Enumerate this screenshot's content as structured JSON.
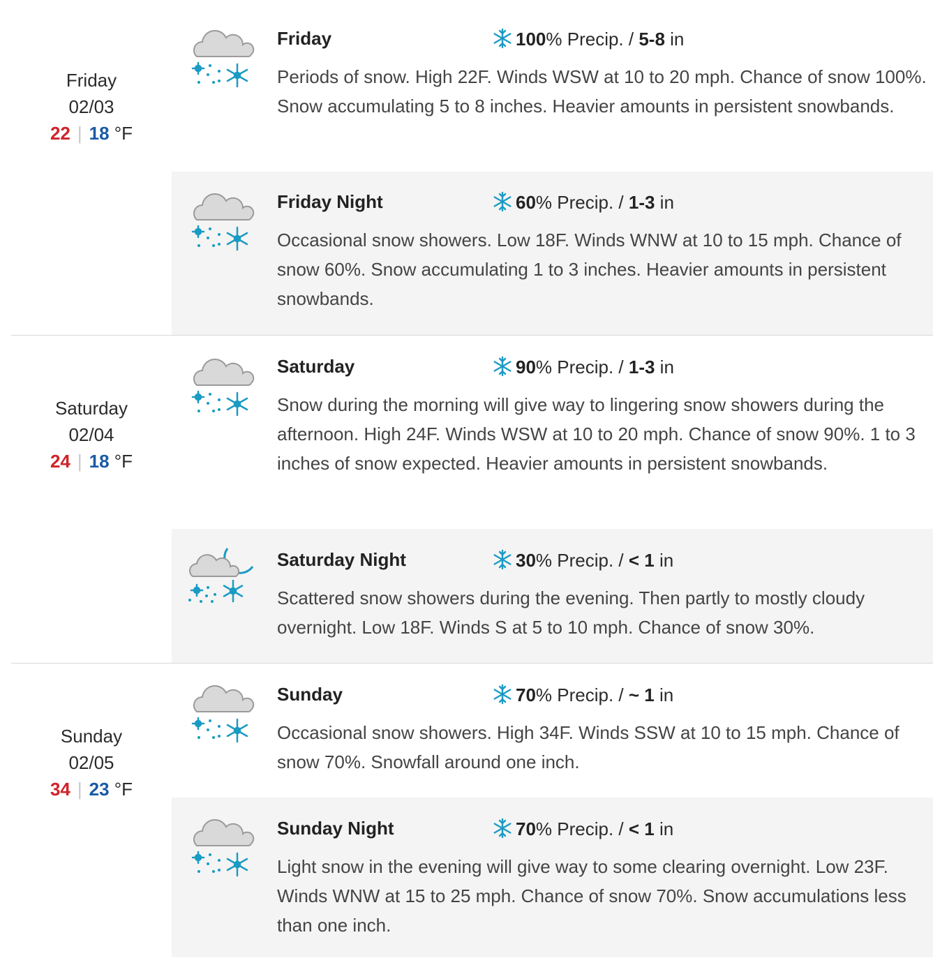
{
  "icons": {
    "snow": "cloud-snow-icon",
    "night_snow": "moon-cloud-snow-icon",
    "precip": "snowflake-icon"
  },
  "colors": {
    "high": "#d0232b",
    "low": "#1a5aa6",
    "snow_blue": "#1a9bc4",
    "cloud": "#d9d9d9",
    "night_bg": "#f4f4f4"
  },
  "days": [
    {
      "weekday": "Friday",
      "date": "02/03",
      "high": "22",
      "low": "18",
      "unit": "°F",
      "day": {
        "name": "Friday",
        "precip_pct": "100",
        "precip_label": "% Precip. / ",
        "amount": "5-8",
        "amount_unit": " in",
        "narrative": "Periods of snow. High 22F. Winds WSW at 10 to 20 mph. Chance of snow 100%. Snow accumulating 5 to 8 inches. Heavier amounts in persistent snowbands."
      },
      "night": {
        "name": "Friday Night",
        "precip_pct": "60",
        "precip_label": "% Precip. / ",
        "amount": "1-3",
        "amount_unit": " in",
        "narrative": "Occasional snow showers. Low 18F. Winds WNW at 10 to 15 mph. Chance of snow 60%. Snow accumulating 1 to 3 inches. Heavier amounts in persistent snowbands."
      }
    },
    {
      "weekday": "Saturday",
      "date": "02/04",
      "high": "24",
      "low": "18",
      "unit": "°F",
      "day": {
        "name": "Saturday",
        "precip_pct": "90",
        "precip_label": "% Precip. / ",
        "amount": "1-3",
        "amount_unit": " in",
        "narrative": "Snow during the morning will give way to lingering snow showers during the afternoon. High 24F. Winds WSW at 10 to 20 mph. Chance of snow 90%. 1 to 3 inches of snow expected. Heavier amounts in persistent snowbands."
      },
      "night": {
        "name": "Saturday Night",
        "precip_pct": "30",
        "precip_label": "% Precip. / ",
        "amount": "< 1",
        "amount_unit": " in",
        "narrative": "Scattered snow showers during the evening. Then partly to mostly cloudy overnight. Low 18F. Winds S at 5 to 10 mph. Chance of snow 30%."
      }
    },
    {
      "weekday": "Sunday",
      "date": "02/05",
      "high": "34",
      "low": "23",
      "unit": "°F",
      "day": {
        "name": "Sunday",
        "precip_pct": "70",
        "precip_label": "% Precip. / ",
        "amount": "~ 1",
        "amount_unit": " in",
        "narrative": "Occasional snow showers. High 34F. Winds SSW at 10 to 15 mph. Chance of snow 70%. Snowfall around one inch."
      },
      "night": {
        "name": "Sunday Night",
        "precip_pct": "70",
        "precip_label": "% Precip. / ",
        "amount": "< 1",
        "amount_unit": " in",
        "narrative": "Light snow in the evening will give way to some clearing overnight. Low 23F. Winds WNW at 15 to 25 mph. Chance of snow 70%. Snow accumulations less than one inch."
      }
    }
  ]
}
